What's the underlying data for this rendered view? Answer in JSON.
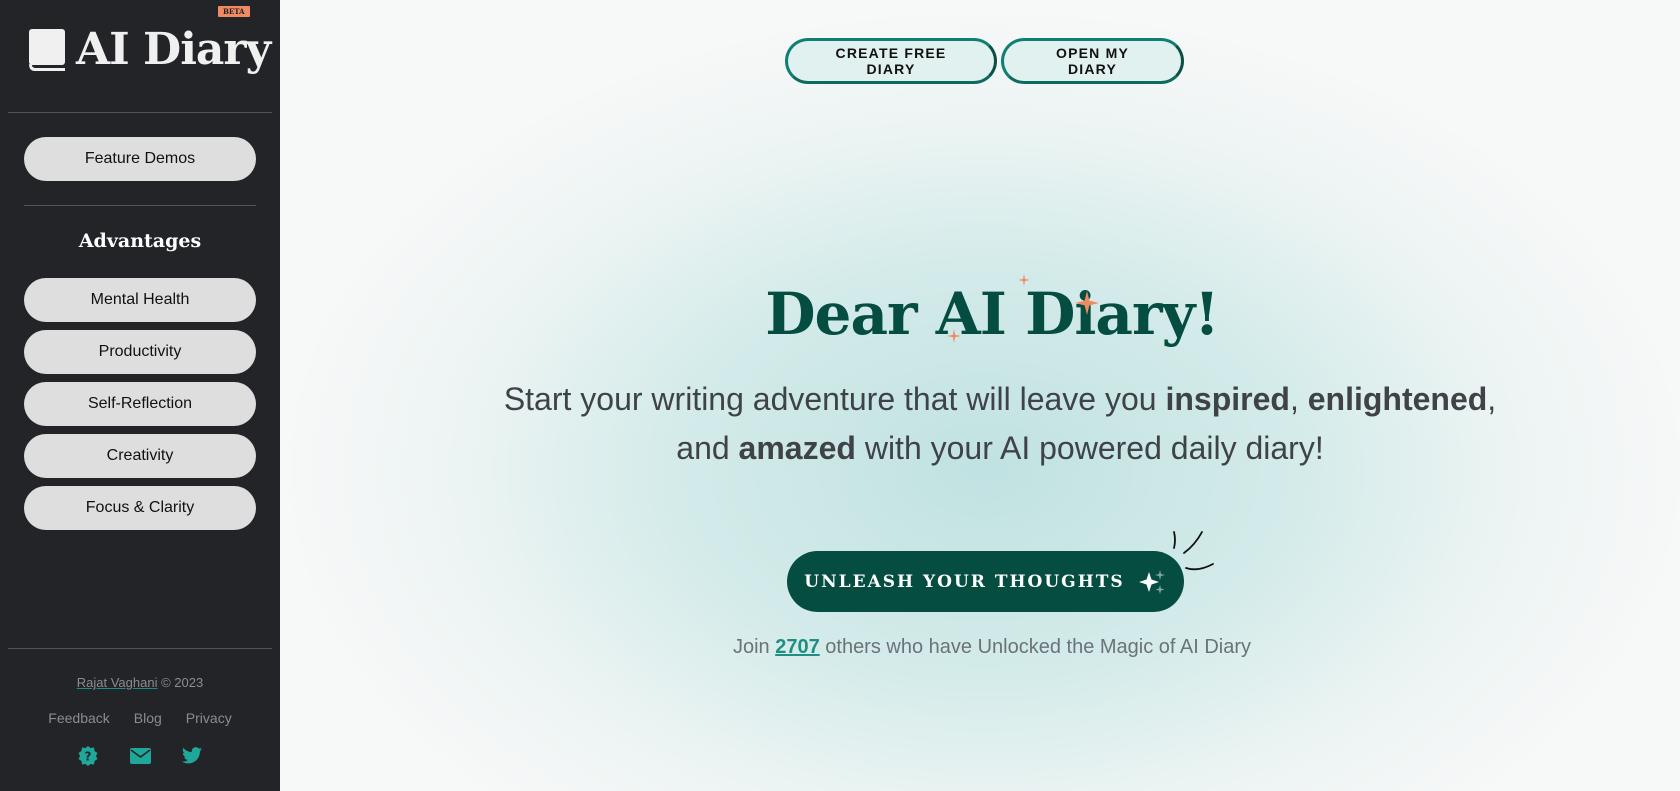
{
  "sidebar": {
    "logo": {
      "title": "AI Diary",
      "badge": "BETA",
      "icon": "book-icon"
    },
    "feature_demos_label": "Feature Demos",
    "section_title": "Advantages",
    "items": [
      {
        "label": "Mental Health"
      },
      {
        "label": "Productivity"
      },
      {
        "label": "Self-Reflection"
      },
      {
        "label": "Creativity"
      },
      {
        "label": "Focus & Clarity"
      }
    ],
    "footer": {
      "author": "Rajat Vaghani",
      "copyright": "© 2023",
      "links": [
        {
          "label": "Feedback"
        },
        {
          "label": "Blog"
        },
        {
          "label": "Privacy"
        }
      ],
      "icons": [
        "help-badge-icon",
        "envelope-icon",
        "twitter-icon"
      ],
      "accent": "#1fa89a"
    }
  },
  "header": {
    "create_label": "CREATE FREE DIARY",
    "open_label": "OPEN MY DIARY"
  },
  "hero": {
    "title": "Dear AI Diary!",
    "subtitle": {
      "part1": "Start your writing adventure that will leave you ",
      "bold1": "inspired",
      "sep1": ", ",
      "bold2": "enlightened",
      "sep2": ",",
      "part2": "and ",
      "bold3": "amazed",
      "part3": " with your AI powered daily diary!"
    },
    "cta_label": "UNLEASH YOUR THOUGHTS",
    "join": {
      "prefix": "Join ",
      "count": "2707",
      "suffix": " others who have Unlocked the Magic of AI Diary"
    }
  },
  "colors": {
    "sidebar_bg": "#222428",
    "brand_dark": "#054d41",
    "accent_teal": "#1f8f84",
    "sparkle": "#ef8a62"
  }
}
